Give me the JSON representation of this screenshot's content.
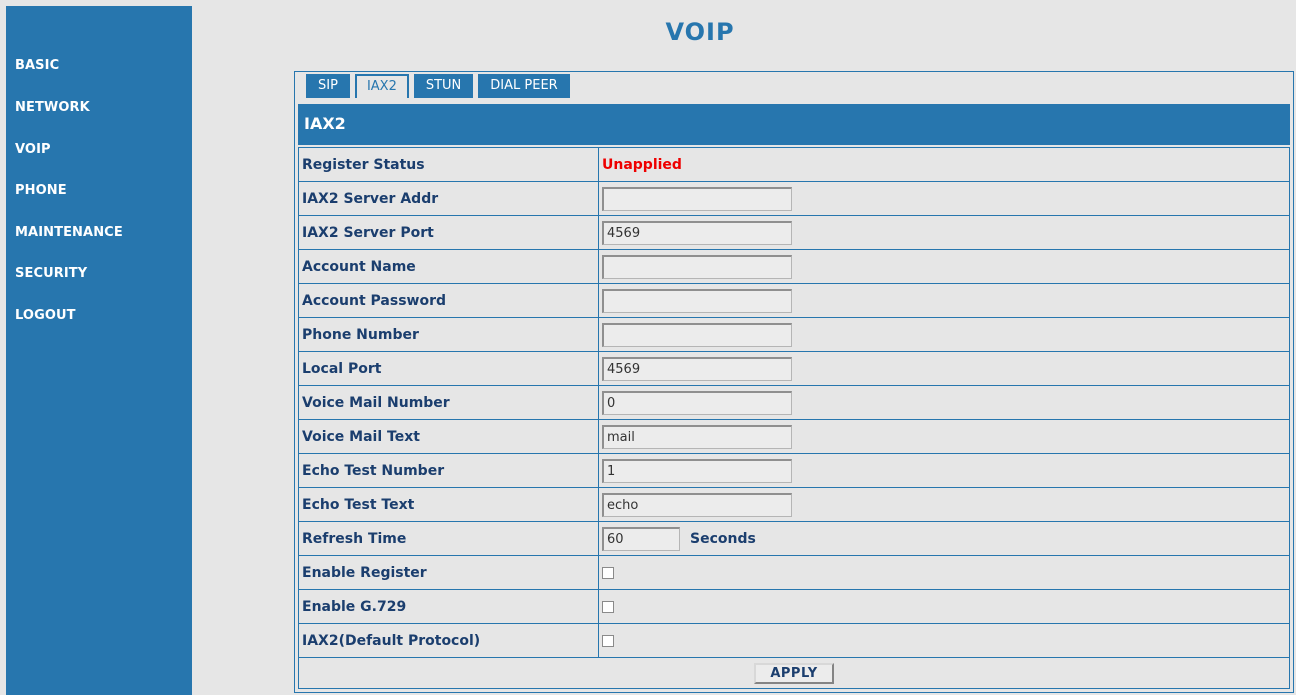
{
  "title": "VOIP",
  "sidebar": {
    "items": [
      "BASIC",
      "NETWORK",
      "VOIP",
      "PHONE",
      "MAINTENANCE",
      "SECURITY",
      "LOGOUT"
    ]
  },
  "tabs": {
    "items": [
      "SIP",
      "IAX2",
      "STUN",
      "DIAL PEER"
    ],
    "active": "IAX2"
  },
  "section": {
    "title": "IAX2"
  },
  "form": {
    "register_status": {
      "label": "Register Status",
      "value": "Unapplied",
      "color": "#ee0000"
    },
    "server_addr": {
      "label": "IAX2 Server Addr",
      "value": ""
    },
    "server_port": {
      "label": "IAX2 Server Port",
      "value": "4569"
    },
    "account_name": {
      "label": "Account Name",
      "value": ""
    },
    "account_password": {
      "label": "Account Password",
      "value": ""
    },
    "phone_number": {
      "label": "Phone Number",
      "value": ""
    },
    "local_port": {
      "label": "Local Port",
      "value": "4569"
    },
    "voice_mail_number": {
      "label": "Voice Mail Number",
      "value": "0"
    },
    "voice_mail_text": {
      "label": "Voice Mail Text",
      "value": "mail"
    },
    "echo_test_number": {
      "label": "Echo Test Number",
      "value": "1"
    },
    "echo_test_text": {
      "label": "Echo Test Text",
      "value": "echo"
    },
    "refresh_time": {
      "label": "Refresh Time",
      "value": "60",
      "unit": "Seconds"
    },
    "enable_register": {
      "label": "Enable Register",
      "checked": false
    },
    "enable_g729": {
      "label": "Enable G.729",
      "checked": false
    },
    "default_protocol": {
      "label": "IAX2(Default Protocol)",
      "checked": false
    }
  },
  "apply_label": "APPLY",
  "colors": {
    "accent": "#2776ae",
    "background": "#e6e6e6",
    "label": "#1b3e6e"
  }
}
